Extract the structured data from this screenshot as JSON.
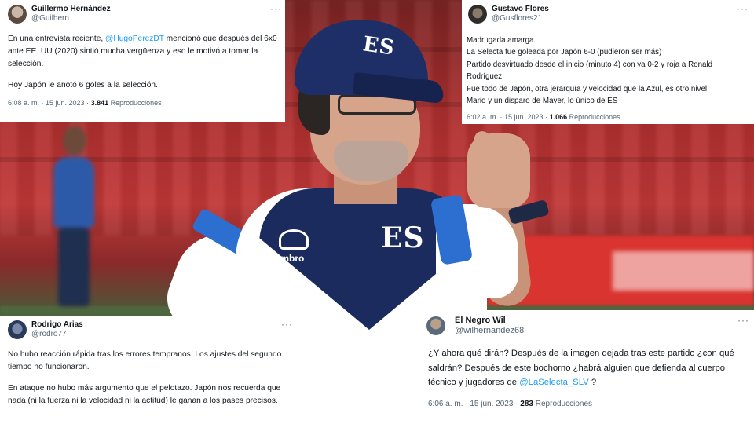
{
  "background": {
    "cap_text": "ES",
    "chest_text": "ES",
    "brand_text": "umbro"
  },
  "tweets": [
    {
      "name": "Guillermo Hernández",
      "handle": "@Guilhern",
      "more": "···",
      "text_line1_pre": "En una entrevista reciente, ",
      "mention": "@HugoPerezDT",
      "text_line1_post": " mencionó que después del 6x0 ante EE. UU (2020) sintió mucha vergüenza y eso le motivó a tomar la selección.",
      "text_line2": "Hoy Japón le anotó 6 goles a la selección.",
      "time": "6:08 a. m. · 15 jun. 2023 · ",
      "views": "3.841",
      "views_label": " Reproducciones"
    },
    {
      "name": "Gustavo Flores",
      "handle": "@Gusflores21",
      "more": "···",
      "lines": [
        "Madrugada amarga.",
        "La Selecta fue goleada por Japón 6-0 (pudieron ser más)",
        "Partido desvirtuado desde el inicio (minuto 4) con ya 0-2 y roja a Ronald Rodríguez.",
        "Fue todo de Japón,  otra jerarquía y velocidad que la Azul, es otro nivel.",
        "Mario y un disparo de Mayer, lo único de ES"
      ],
      "time": "6:02 a. m. · 15 jun. 2023 · ",
      "views": "1.066",
      "views_label": " Reproducciones"
    },
    {
      "name": "Rodrigo Arias",
      "handle": "@rodro77",
      "more": "···",
      "text_line1": "No hubo reacción rápida tras los errores tempranos. Los ajustes del segundo tiempo no funcionaron.",
      "text_line2": "En ataque no hubo más argumento que el pelotazo. Japón nos recuerda que nada (ni la fuerza ni la velocidad ni la actitud) le ganan a los pases precisos."
    },
    {
      "name": "El Negro Wil",
      "handle": "@wilhernandez68",
      "more": "···",
      "text_pre": "¿Y ahora qué dirán? Después de la imagen dejada tras este partido ¿con qué saldrán? Después de este bochorno ¿habrá alguien que defienda al cuerpo técnico y jugadores de ",
      "mention": "@LaSelecta_SLV",
      "text_post": " ?",
      "time": "6:06 a. m. · 15 jun. 2023 · ",
      "views": "283",
      "views_label": " Reproducciones"
    }
  ],
  "colors": {
    "link": "#1d9bf0",
    "secondary_text": "#536471",
    "primary_text": "#0f1419",
    "jersey_navy": "#1c2b5e",
    "jersey_blue": "#2d6fd0"
  }
}
